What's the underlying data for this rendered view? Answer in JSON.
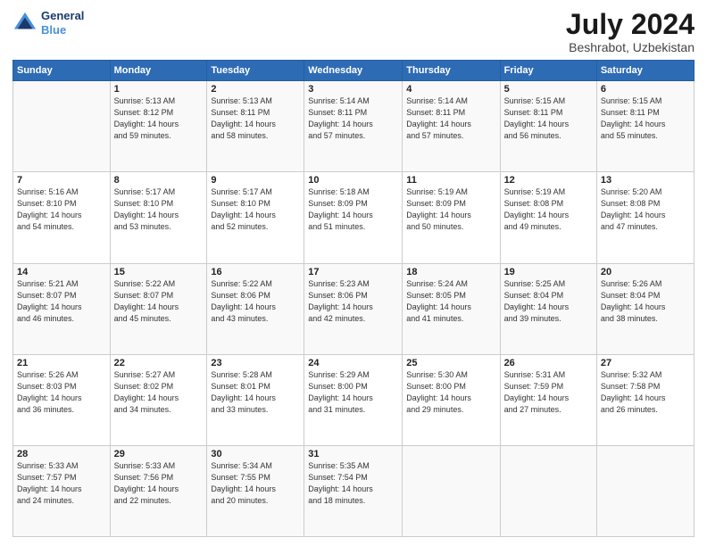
{
  "header": {
    "logo_line1": "General",
    "logo_line2": "Blue",
    "month_year": "July 2024",
    "location": "Beshrabot, Uzbekistan"
  },
  "days_of_week": [
    "Sunday",
    "Monday",
    "Tuesday",
    "Wednesday",
    "Thursday",
    "Friday",
    "Saturday"
  ],
  "weeks": [
    [
      {
        "day": "",
        "info": ""
      },
      {
        "day": "1",
        "info": "Sunrise: 5:13 AM\nSunset: 8:12 PM\nDaylight: 14 hours\nand 59 minutes."
      },
      {
        "day": "2",
        "info": "Sunrise: 5:13 AM\nSunset: 8:11 PM\nDaylight: 14 hours\nand 58 minutes."
      },
      {
        "day": "3",
        "info": "Sunrise: 5:14 AM\nSunset: 8:11 PM\nDaylight: 14 hours\nand 57 minutes."
      },
      {
        "day": "4",
        "info": "Sunrise: 5:14 AM\nSunset: 8:11 PM\nDaylight: 14 hours\nand 57 minutes."
      },
      {
        "day": "5",
        "info": "Sunrise: 5:15 AM\nSunset: 8:11 PM\nDaylight: 14 hours\nand 56 minutes."
      },
      {
        "day": "6",
        "info": "Sunrise: 5:15 AM\nSunset: 8:11 PM\nDaylight: 14 hours\nand 55 minutes."
      }
    ],
    [
      {
        "day": "7",
        "info": "Sunrise: 5:16 AM\nSunset: 8:10 PM\nDaylight: 14 hours\nand 54 minutes."
      },
      {
        "day": "8",
        "info": "Sunrise: 5:17 AM\nSunset: 8:10 PM\nDaylight: 14 hours\nand 53 minutes."
      },
      {
        "day": "9",
        "info": "Sunrise: 5:17 AM\nSunset: 8:10 PM\nDaylight: 14 hours\nand 52 minutes."
      },
      {
        "day": "10",
        "info": "Sunrise: 5:18 AM\nSunset: 8:09 PM\nDaylight: 14 hours\nand 51 minutes."
      },
      {
        "day": "11",
        "info": "Sunrise: 5:19 AM\nSunset: 8:09 PM\nDaylight: 14 hours\nand 50 minutes."
      },
      {
        "day": "12",
        "info": "Sunrise: 5:19 AM\nSunset: 8:08 PM\nDaylight: 14 hours\nand 49 minutes."
      },
      {
        "day": "13",
        "info": "Sunrise: 5:20 AM\nSunset: 8:08 PM\nDaylight: 14 hours\nand 47 minutes."
      }
    ],
    [
      {
        "day": "14",
        "info": "Sunrise: 5:21 AM\nSunset: 8:07 PM\nDaylight: 14 hours\nand 46 minutes."
      },
      {
        "day": "15",
        "info": "Sunrise: 5:22 AM\nSunset: 8:07 PM\nDaylight: 14 hours\nand 45 minutes."
      },
      {
        "day": "16",
        "info": "Sunrise: 5:22 AM\nSunset: 8:06 PM\nDaylight: 14 hours\nand 43 minutes."
      },
      {
        "day": "17",
        "info": "Sunrise: 5:23 AM\nSunset: 8:06 PM\nDaylight: 14 hours\nand 42 minutes."
      },
      {
        "day": "18",
        "info": "Sunrise: 5:24 AM\nSunset: 8:05 PM\nDaylight: 14 hours\nand 41 minutes."
      },
      {
        "day": "19",
        "info": "Sunrise: 5:25 AM\nSunset: 8:04 PM\nDaylight: 14 hours\nand 39 minutes."
      },
      {
        "day": "20",
        "info": "Sunrise: 5:26 AM\nSunset: 8:04 PM\nDaylight: 14 hours\nand 38 minutes."
      }
    ],
    [
      {
        "day": "21",
        "info": "Sunrise: 5:26 AM\nSunset: 8:03 PM\nDaylight: 14 hours\nand 36 minutes."
      },
      {
        "day": "22",
        "info": "Sunrise: 5:27 AM\nSunset: 8:02 PM\nDaylight: 14 hours\nand 34 minutes."
      },
      {
        "day": "23",
        "info": "Sunrise: 5:28 AM\nSunset: 8:01 PM\nDaylight: 14 hours\nand 33 minutes."
      },
      {
        "day": "24",
        "info": "Sunrise: 5:29 AM\nSunset: 8:00 PM\nDaylight: 14 hours\nand 31 minutes."
      },
      {
        "day": "25",
        "info": "Sunrise: 5:30 AM\nSunset: 8:00 PM\nDaylight: 14 hours\nand 29 minutes."
      },
      {
        "day": "26",
        "info": "Sunrise: 5:31 AM\nSunset: 7:59 PM\nDaylight: 14 hours\nand 27 minutes."
      },
      {
        "day": "27",
        "info": "Sunrise: 5:32 AM\nSunset: 7:58 PM\nDaylight: 14 hours\nand 26 minutes."
      }
    ],
    [
      {
        "day": "28",
        "info": "Sunrise: 5:33 AM\nSunset: 7:57 PM\nDaylight: 14 hours\nand 24 minutes."
      },
      {
        "day": "29",
        "info": "Sunrise: 5:33 AM\nSunset: 7:56 PM\nDaylight: 14 hours\nand 22 minutes."
      },
      {
        "day": "30",
        "info": "Sunrise: 5:34 AM\nSunset: 7:55 PM\nDaylight: 14 hours\nand 20 minutes."
      },
      {
        "day": "31",
        "info": "Sunrise: 5:35 AM\nSunset: 7:54 PM\nDaylight: 14 hours\nand 18 minutes."
      },
      {
        "day": "",
        "info": ""
      },
      {
        "day": "",
        "info": ""
      },
      {
        "day": "",
        "info": ""
      }
    ]
  ]
}
